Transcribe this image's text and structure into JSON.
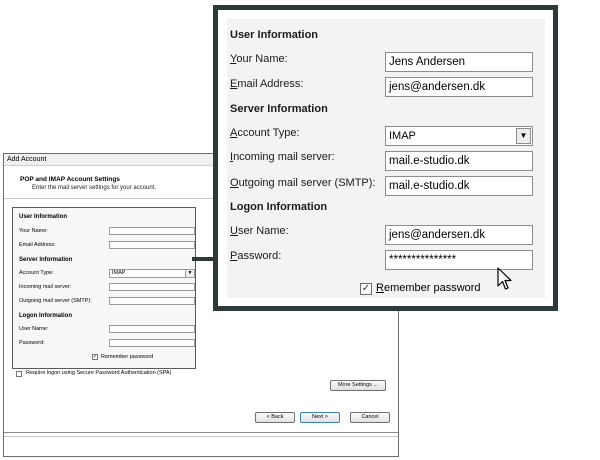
{
  "dialog": {
    "title": "Add Account",
    "header_title": "POP and IMAP Account Settings",
    "header_subtitle": "Enter the mail server settings for your account.",
    "spa_label": "Require logon using Secure Password Authentication (SPA)",
    "more_settings_label": "More Settings ...",
    "back_label": "< Back",
    "next_label": "Next >",
    "cancel_label": "Cancel"
  },
  "form": {
    "user_info_heading": "User Information",
    "your_name_label": "Your Name:",
    "email_label": "Email Address:",
    "server_info_heading": "Server Information",
    "account_type_label": "Account Type:",
    "incoming_label": "Incoming mail server:",
    "outgoing_label": "Outgoing mail server (SMTP):",
    "logon_info_heading": "Logon Information",
    "user_name_label": "User Name:",
    "password_label": "Password:",
    "remember_label": "Remember password",
    "account_type_value": "IMAP"
  },
  "values": {
    "your_name": "Jens Andersen",
    "email": "jens@andersen.dk",
    "account_type": "IMAP",
    "incoming": "mail.e-studio.dk",
    "outgoing": "mail.e-studio.dk",
    "user_name": "jens@andersen.dk",
    "password": "***************",
    "remember_checked": "✓"
  },
  "icons": {
    "dropdown": "chevron-down-icon",
    "cursor": "mouse-pointer-icon"
  }
}
